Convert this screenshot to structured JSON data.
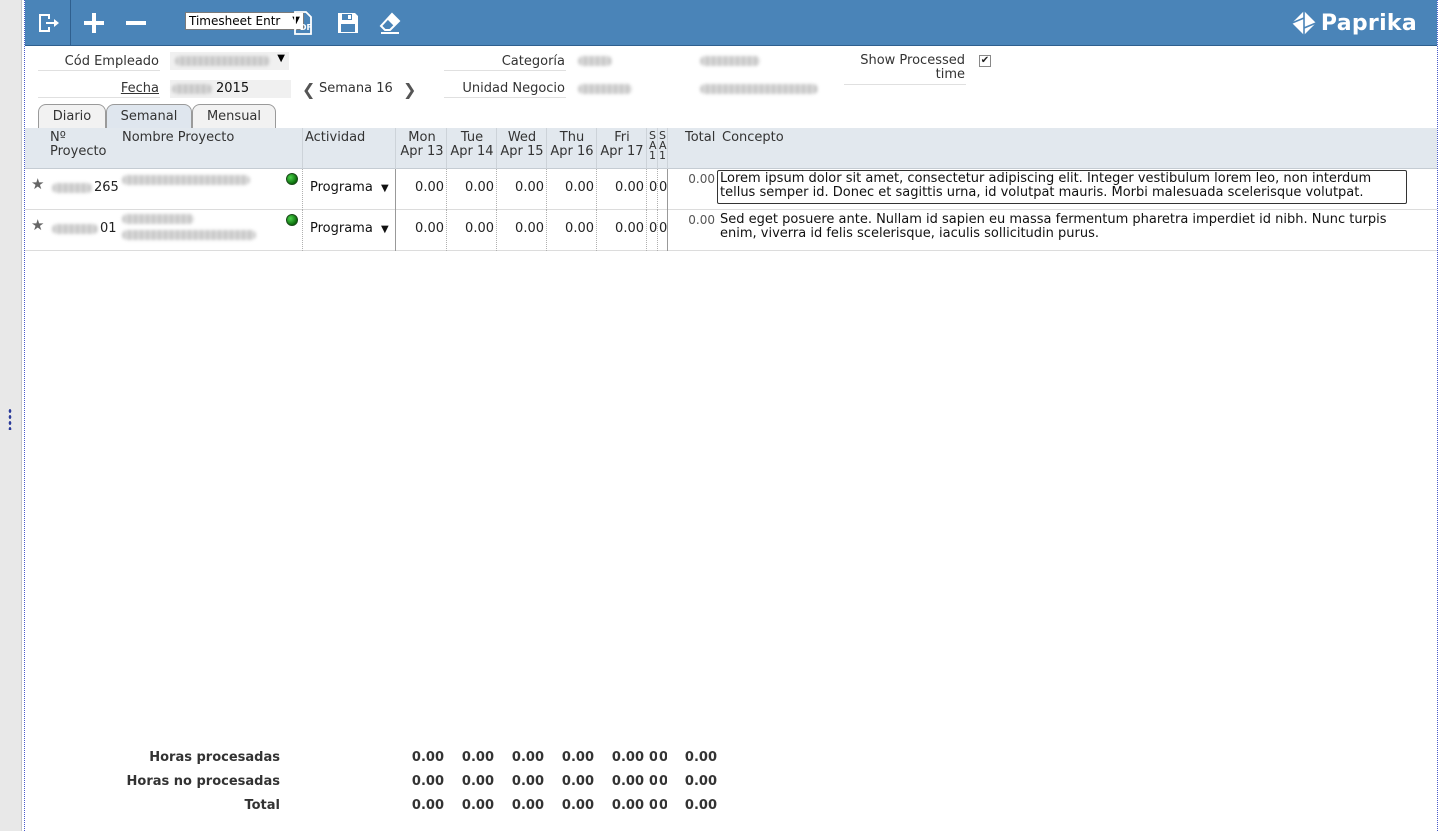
{
  "toolbar": {
    "view_select": "Timesheet Entr",
    "brand": "Paprika"
  },
  "filters": {
    "employee_label": "Cód Empleado",
    "category_label": "Categoría",
    "processed_label_line1": "Show Processed",
    "processed_label_line2": "time",
    "processed_checked": true,
    "date_label": "Fecha",
    "date_year": "2015",
    "week_label": "Semana 16",
    "business_unit_label": "Unidad Negocio"
  },
  "tabs": [
    "Diario",
    "Semanal",
    "Mensual"
  ],
  "active_tab": "Semanal",
  "columns": {
    "project_no_l1": "Nº",
    "project_no_l2": "Proyecto",
    "project_name": "Nombre Proyecto",
    "activity": "Actividad",
    "days": [
      {
        "d": "Mon",
        "date": "Apr 13"
      },
      {
        "d": "Tue",
        "date": "Apr 14"
      },
      {
        "d": "Wed",
        "date": "Apr 15"
      },
      {
        "d": "Thu",
        "date": "Apr 16"
      },
      {
        "d": "Fri",
        "date": "Apr 17"
      }
    ],
    "sat": "S\nA\n1",
    "sun": "S\nA\n1",
    "total": "Total",
    "concept": "Concepto"
  },
  "rows": [
    {
      "project_no_suffix": "265",
      "activity": "Programa",
      "hours": [
        "0.00",
        "0.00",
        "0.00",
        "0.00",
        "0.00"
      ],
      "sat": "0",
      "sun": "0",
      "total": "0.00",
      "concept": "Lorem ipsum dolor sit amet, consectetur adipiscing elit. Integer vestibulum lorem leo, non interdum tellus semper id. Donec et sagittis urna, id volutpat mauris. Morbi malesuada scelerisque volutpat."
    },
    {
      "project_no_suffix": "01",
      "activity": "Programa",
      "hours": [
        "0.00",
        "0.00",
        "0.00",
        "0.00",
        "0.00"
      ],
      "sat": "0",
      "sun": "0",
      "total": "0.00",
      "concept": "Sed eget posuere ante. Nullam id sapien eu massa fermentum pharetra imperdiet id nibh. Nunc turpis enim, viverra id felis scelerisque, iaculis sollicitudin purus."
    }
  ],
  "summary": [
    {
      "label": "Horas procesadas",
      "values": [
        "0.00",
        "0.00",
        "0.00",
        "0.00",
        "0.00"
      ],
      "sat": "0",
      "sun": "0",
      "total": "0.00"
    },
    {
      "label": "Horas no procesadas",
      "values": [
        "0.00",
        "0.00",
        "0.00",
        "0.00",
        "0.00"
      ],
      "sat": "0",
      "sun": "0",
      "total": "0.00"
    },
    {
      "label": "Total",
      "values": [
        "0.00",
        "0.00",
        "0.00",
        "0.00",
        "0.00"
      ],
      "sat": "0",
      "sun": "0",
      "total": "0.00"
    }
  ],
  "colors": {
    "toolbar_bg": "#4a84b8",
    "grid_header_bg": "#e2e8ee",
    "status_ok": "#1a8a1a"
  }
}
